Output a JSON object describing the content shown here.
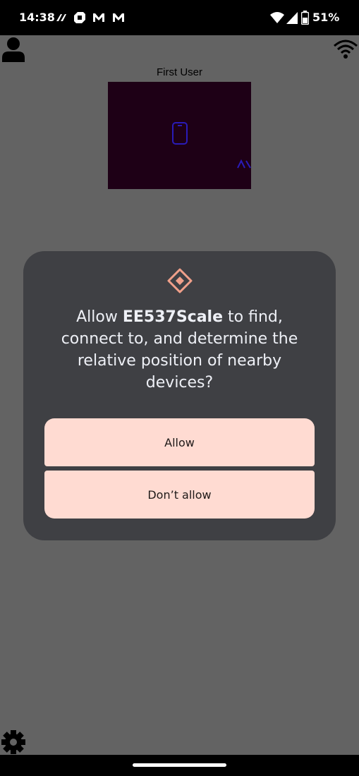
{
  "status_bar": {
    "time": "14:38",
    "battery": "51%",
    "notification_icons": [
      "app-notification-icon",
      "chase-icon",
      "gmail-icon",
      "gmail-icon"
    ],
    "right_icons": [
      "wifi-icon",
      "cell-signal-icon",
      "battery-icon"
    ]
  },
  "app": {
    "user_name": "First User",
    "icons": [
      "user-icon",
      "wifi-icon",
      "gear-icon"
    ]
  },
  "dialog": {
    "message_prefix": "Allow ",
    "app_name": "EE537Scale",
    "message_suffix": " to find, connect to, and determine the relative position of nearby devices?",
    "allow_label": "Allow",
    "deny_label": "Don’t allow",
    "icon": "nearby-devices-icon"
  },
  "colors": {
    "status_bar_bg": "#000000",
    "app_bg": "#636363",
    "dialog_bg": "#3f4044",
    "button_bg": "#ffdbd2",
    "accent_icon": "#f0a08a",
    "preview_bg": "#1e0016"
  }
}
